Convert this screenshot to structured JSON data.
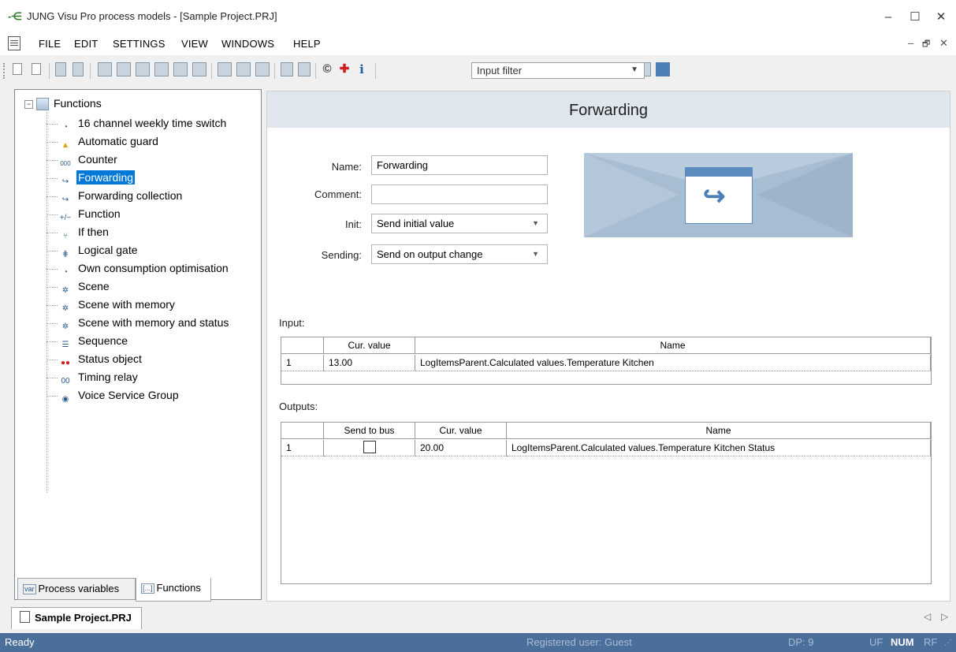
{
  "window": {
    "title": "JUNG Visu Pro process models - [Sample Project.PRJ]",
    "app_icon": "app-logo-icon",
    "controls": {
      "minimize": "–",
      "maximize": "☐",
      "close": "✕"
    }
  },
  "menu": {
    "items": [
      "FILE",
      "EDIT",
      "SETTINGS",
      "VIEW",
      "WINDOWS",
      "HELP"
    ],
    "mdi_controls": {
      "minimize": "–",
      "restore": "🗗",
      "close": "✕"
    }
  },
  "toolbar": {
    "input_filter": "Input filter",
    "copyright_glyph": "©",
    "add_glyph": "✚",
    "info_glyph": "i"
  },
  "tree": {
    "root": "Functions",
    "items": [
      {
        "label": "16 channel weekly time switch",
        "icon": "clock-icon"
      },
      {
        "label": "Automatic guard",
        "icon": "warning-triangle-icon"
      },
      {
        "label": "Counter",
        "icon": "counter-icon"
      },
      {
        "label": "Forwarding",
        "icon": "forward-arrow-icon",
        "selected": true
      },
      {
        "label": "Forwarding collection",
        "icon": "forward-arrow-icon"
      },
      {
        "label": "Function",
        "icon": "function-icon"
      },
      {
        "label": "If then",
        "icon": "if-then-icon"
      },
      {
        "label": "Logical gate",
        "icon": "logic-gate-icon"
      },
      {
        "label": "Own consumption optimisation",
        "icon": "clock-icon"
      },
      {
        "label": "Scene",
        "icon": "scene-icon"
      },
      {
        "label": "Scene with memory",
        "icon": "scene-memory-icon"
      },
      {
        "label": "Scene with memory and status",
        "icon": "scene-memory-icon"
      },
      {
        "label": "Sequence",
        "icon": "sequence-icon"
      },
      {
        "label": "Status object",
        "icon": "status-object-icon"
      },
      {
        "label": "Timing relay",
        "icon": "timing-relay-icon"
      },
      {
        "label": "Voice Service Group",
        "icon": "voice-service-icon"
      }
    ],
    "tabs": [
      "Process variables",
      "Functions"
    ],
    "tab_icons": [
      "var",
      "[...]"
    ]
  },
  "detail": {
    "title": "Forwarding",
    "name_label": "Name:",
    "name_value": "Forwarding",
    "comment_label": "Comment:",
    "comment_value": "",
    "init_label": "Init:",
    "init_value": "Send initial value",
    "sending_label": "Sending:",
    "sending_value": "Send on output change"
  },
  "input_table": {
    "section_label": "Input:",
    "headers": [
      "",
      "Cur. value",
      "Name"
    ],
    "rows": [
      [
        "1",
        "13.00",
        "LogItemsParent.Calculated values.Temperature Kitchen"
      ]
    ]
  },
  "output_table": {
    "section_label": "Outputs:",
    "headers": [
      "",
      "Send to bus",
      "Cur. value",
      "Name"
    ],
    "rows": [
      [
        "1",
        false,
        "20.00",
        "LogItemsParent.Calculated values.Temperature Kitchen Status"
      ]
    ]
  },
  "doc_tab": "Sample Project.PRJ",
  "statusbar": {
    "status": "Ready",
    "user": "Registered user: Guest",
    "dp": "DP: 9",
    "uf": "UF",
    "num": "NUM",
    "rf": "RF"
  },
  "colors": {
    "statusbar": "#4b6f9b",
    "selection": "#0078d7",
    "header": "#dfe6ee"
  }
}
